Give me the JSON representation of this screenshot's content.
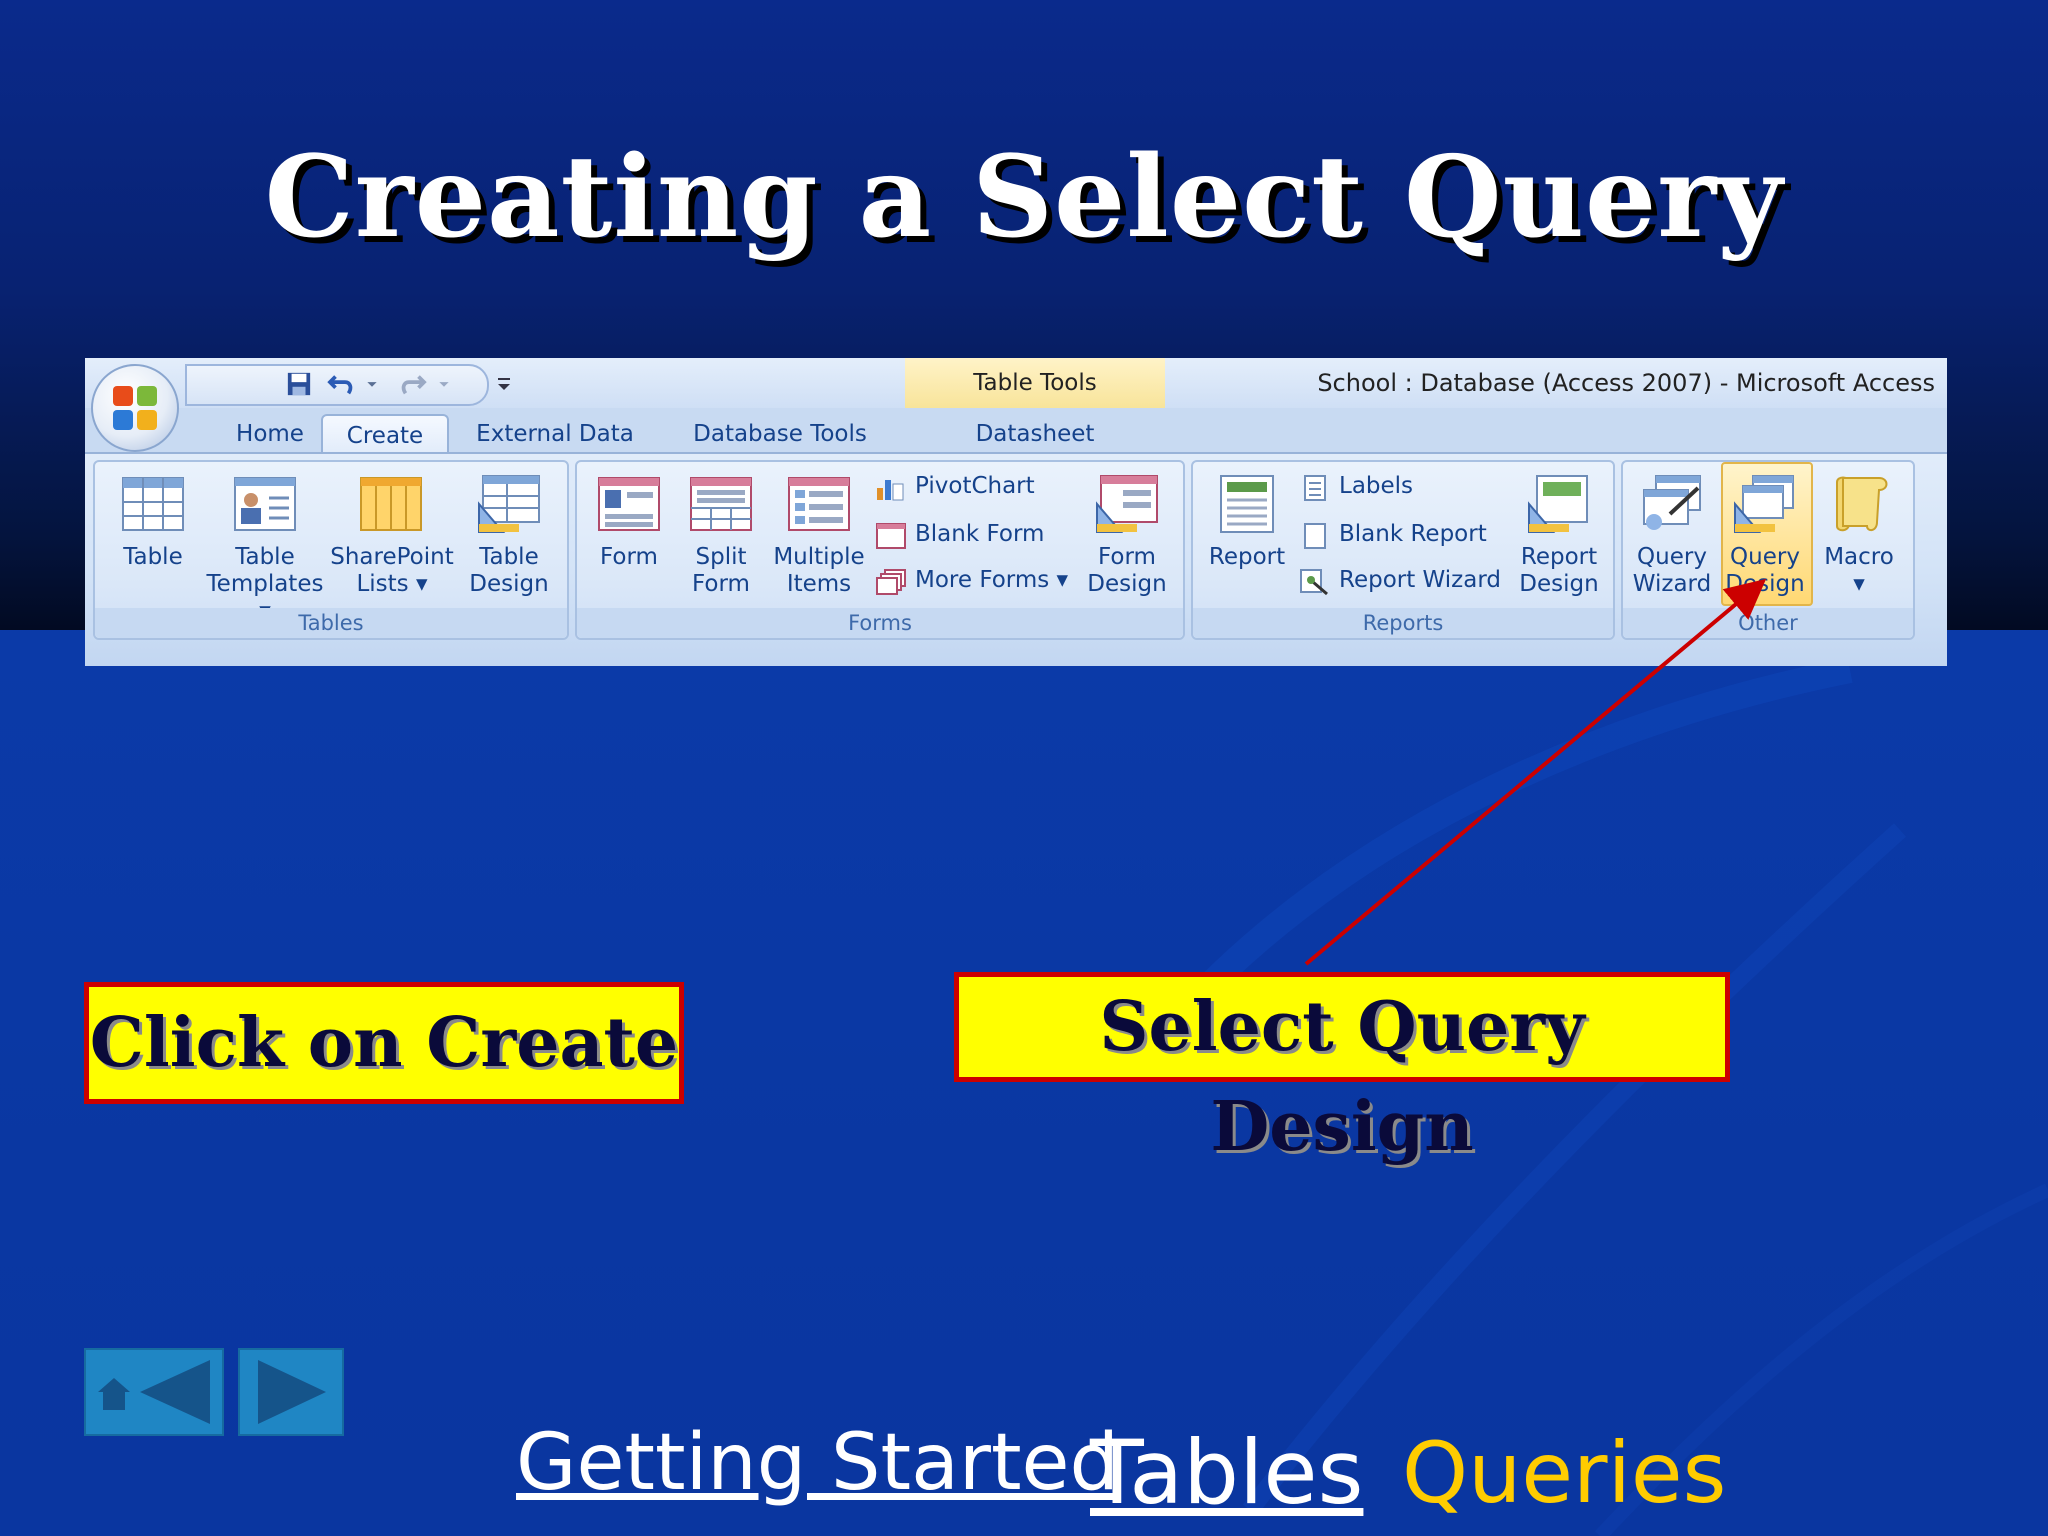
{
  "slide": {
    "title": "Creating a Select Query"
  },
  "ribbon": {
    "context_tab_title": "Table Tools",
    "window_title": "School : Database (Access 2007)  -  Microsoft Access",
    "tabs": [
      {
        "label": "Home",
        "active": false
      },
      {
        "label": "Create",
        "active": true
      },
      {
        "label": "External Data",
        "active": false
      },
      {
        "label": "Database Tools",
        "active": false
      },
      {
        "label": "Datasheet",
        "active": false
      }
    ],
    "groups": {
      "tables": {
        "label": "Tables",
        "buttons": [
          {
            "line1": "Table",
            "line2": ""
          },
          {
            "line1": "Table",
            "line2": "Templates ▾"
          },
          {
            "line1": "SharePoint",
            "line2": "Lists ▾"
          },
          {
            "line1": "Table",
            "line2": "Design"
          }
        ]
      },
      "forms": {
        "label": "Forms",
        "buttons": [
          {
            "line1": "Form",
            "line2": ""
          },
          {
            "line1": "Split",
            "line2": "Form"
          },
          {
            "line1": "Multiple",
            "line2": "Items"
          },
          {
            "line1": "Form",
            "line2": "Design"
          }
        ],
        "small_buttons": [
          "PivotChart",
          "Blank Form",
          "More Forms ▾"
        ]
      },
      "reports": {
        "label": "Reports",
        "buttons": [
          {
            "line1": "Report",
            "line2": ""
          },
          {
            "line1": "Report",
            "line2": "Design"
          }
        ],
        "small_buttons": [
          "Labels",
          "Blank Report",
          "Report Wizard"
        ]
      },
      "other": {
        "label": "Other",
        "buttons": [
          {
            "line1": "Query",
            "line2": "Wizard"
          },
          {
            "line1": "Query",
            "line2": "Design"
          },
          {
            "line1": "Macro",
            "line2": "▾"
          }
        ]
      }
    }
  },
  "callouts": {
    "click_create": "Click on Create",
    "select_query_design": "Select Query Design"
  },
  "footer": {
    "links": [
      "Getting Started",
      "Tables",
      "Queries"
    ]
  },
  "colors": {
    "background": "#0a35a6",
    "callout_fill": "#ffff00",
    "callout_border": "#cc0000",
    "arrow": "#cc0000",
    "queries_link": "#ffcc00"
  },
  "icons": {
    "nav": [
      "home-icon",
      "back-arrow-icon",
      "forward-arrow-icon"
    ]
  }
}
